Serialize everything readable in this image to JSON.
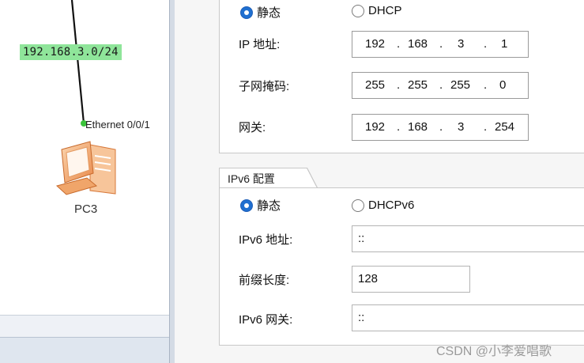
{
  "topology": {
    "network_label": "192.168.3.0/24",
    "port_label": "Ethernet 0/0/1",
    "pc_name": "PC3"
  },
  "ipv4": {
    "mode_static": "静态",
    "mode_dhcp": "DHCP",
    "selected": "static",
    "ip_label": "IP 地址:",
    "ip": [
      "192",
      "168",
      "3",
      "1"
    ],
    "mask_label": "子网掩码:",
    "mask": [
      "255",
      "255",
      "255",
      "0"
    ],
    "gateway_label": "网关:",
    "gateway": [
      "192",
      "168",
      "3",
      "254"
    ]
  },
  "ipv6": {
    "tab_label": "IPv6 配置",
    "mode_static": "静态",
    "mode_dhcp": "DHCPv6",
    "selected": "static",
    "address_label": "IPv6 地址:",
    "address_value": "::",
    "prefix_label": "前缀长度:",
    "prefix_value": "128",
    "gateway_label": "IPv6 网关:",
    "gateway_value": "::"
  },
  "watermark": "CSDN @小李爱唱歌",
  "colors": {
    "network_label_bg": "#8fe59a",
    "radio_selected": "#1f6fd0",
    "port_dot": "#3cc43c"
  }
}
